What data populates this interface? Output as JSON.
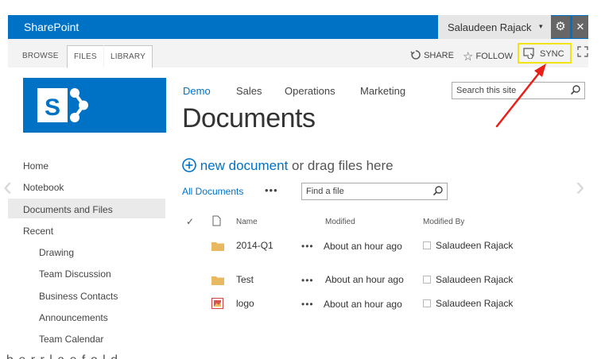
{
  "suite_bar": {
    "brand": "SharePoint",
    "user_name": "Salaudeen Rajack",
    "user_chevron": "▾",
    "settings_icon": "gear-icon",
    "help_icon": "close-icon"
  },
  "ribbon": {
    "tabs": [
      "BROWSE",
      "FILES",
      "LIBRARY"
    ],
    "actions": {
      "share": "SHARE",
      "follow": "FOLLOW",
      "sync": "SYNC"
    },
    "sync_highlight_color": "#f2e40e"
  },
  "top_nav": {
    "links": [
      "Demo",
      "Sales",
      "Operations",
      "Marketing"
    ],
    "active_index": 0
  },
  "search": {
    "placeholder": "Search this site"
  },
  "page_title": "Documents",
  "left_nav": {
    "items": [
      "Home",
      "Notebook",
      "Documents and Files",
      "Recent"
    ],
    "selected": "Documents and Files",
    "recent_items": [
      "Drawing",
      "Team Discussion",
      "Business Contacts",
      "Announcements",
      "Team Calendar"
    ]
  },
  "content": {
    "new_document_link": "new document",
    "drag_text": "or drag files here",
    "view_name": "All Documents",
    "view_ellipsis": "•••",
    "find_placeholder": "Find a file"
  },
  "table": {
    "headers": {
      "name": "Name",
      "modified": "Modified",
      "modified_by": "Modified By"
    },
    "rows": [
      {
        "type": "folder",
        "name": "2014-Q1",
        "ellipsis": "•••",
        "modified": "About an hour ago",
        "modified_by": "Salaudeen Rajack"
      },
      {
        "type": "folder",
        "name": "Test",
        "ellipsis": "•••",
        "modified": "About an hour ago",
        "modified_by": "Salaudeen Rajack"
      },
      {
        "type": "image",
        "name": "logo",
        "ellipsis": "•••",
        "modified": "About an hour ago",
        "modified_by": "Salaudeen Rajack"
      }
    ]
  },
  "colors": {
    "brand_blue": "#0072c6",
    "annotation_arrow": "#e8201a"
  }
}
